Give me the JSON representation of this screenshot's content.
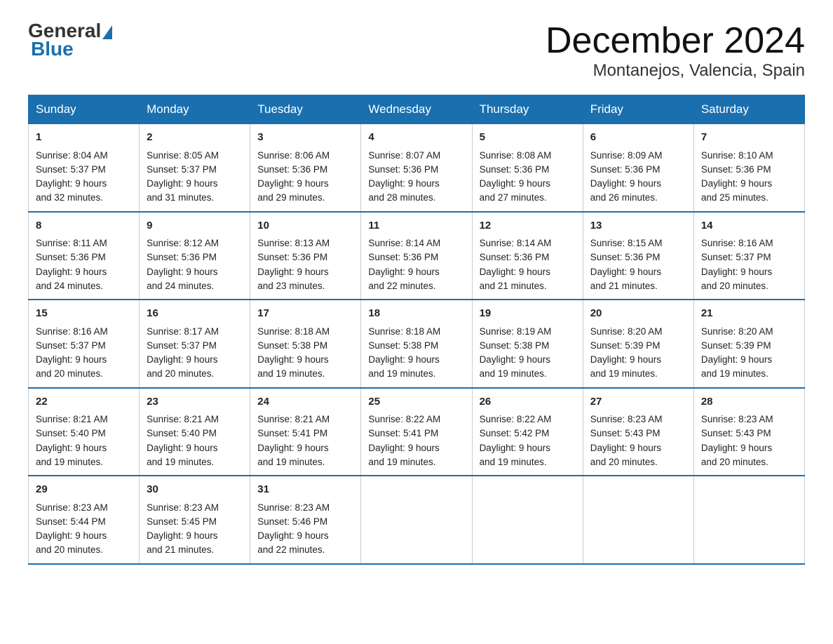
{
  "logo": {
    "general": "General",
    "blue": "Blue"
  },
  "header": {
    "month_year": "December 2024",
    "location": "Montanejos, Valencia, Spain"
  },
  "days_of_week": [
    "Sunday",
    "Monday",
    "Tuesday",
    "Wednesday",
    "Thursday",
    "Friday",
    "Saturday"
  ],
  "weeks": [
    [
      {
        "day": 1,
        "sunrise": "8:04 AM",
        "sunset": "5:37 PM",
        "daylight": "9 hours and 32 minutes."
      },
      {
        "day": 2,
        "sunrise": "8:05 AM",
        "sunset": "5:37 PM",
        "daylight": "9 hours and 31 minutes."
      },
      {
        "day": 3,
        "sunrise": "8:06 AM",
        "sunset": "5:36 PM",
        "daylight": "9 hours and 29 minutes."
      },
      {
        "day": 4,
        "sunrise": "8:07 AM",
        "sunset": "5:36 PM",
        "daylight": "9 hours and 28 minutes."
      },
      {
        "day": 5,
        "sunrise": "8:08 AM",
        "sunset": "5:36 PM",
        "daylight": "9 hours and 27 minutes."
      },
      {
        "day": 6,
        "sunrise": "8:09 AM",
        "sunset": "5:36 PM",
        "daylight": "9 hours and 26 minutes."
      },
      {
        "day": 7,
        "sunrise": "8:10 AM",
        "sunset": "5:36 PM",
        "daylight": "9 hours and 25 minutes."
      }
    ],
    [
      {
        "day": 8,
        "sunrise": "8:11 AM",
        "sunset": "5:36 PM",
        "daylight": "9 hours and 24 minutes."
      },
      {
        "day": 9,
        "sunrise": "8:12 AM",
        "sunset": "5:36 PM",
        "daylight": "9 hours and 24 minutes."
      },
      {
        "day": 10,
        "sunrise": "8:13 AM",
        "sunset": "5:36 PM",
        "daylight": "9 hours and 23 minutes."
      },
      {
        "day": 11,
        "sunrise": "8:14 AM",
        "sunset": "5:36 PM",
        "daylight": "9 hours and 22 minutes."
      },
      {
        "day": 12,
        "sunrise": "8:14 AM",
        "sunset": "5:36 PM",
        "daylight": "9 hours and 21 minutes."
      },
      {
        "day": 13,
        "sunrise": "8:15 AM",
        "sunset": "5:36 PM",
        "daylight": "9 hours and 21 minutes."
      },
      {
        "day": 14,
        "sunrise": "8:16 AM",
        "sunset": "5:37 PM",
        "daylight": "9 hours and 20 minutes."
      }
    ],
    [
      {
        "day": 15,
        "sunrise": "8:16 AM",
        "sunset": "5:37 PM",
        "daylight": "9 hours and 20 minutes."
      },
      {
        "day": 16,
        "sunrise": "8:17 AM",
        "sunset": "5:37 PM",
        "daylight": "9 hours and 20 minutes."
      },
      {
        "day": 17,
        "sunrise": "8:18 AM",
        "sunset": "5:38 PM",
        "daylight": "9 hours and 19 minutes."
      },
      {
        "day": 18,
        "sunrise": "8:18 AM",
        "sunset": "5:38 PM",
        "daylight": "9 hours and 19 minutes."
      },
      {
        "day": 19,
        "sunrise": "8:19 AM",
        "sunset": "5:38 PM",
        "daylight": "9 hours and 19 minutes."
      },
      {
        "day": 20,
        "sunrise": "8:20 AM",
        "sunset": "5:39 PM",
        "daylight": "9 hours and 19 minutes."
      },
      {
        "day": 21,
        "sunrise": "8:20 AM",
        "sunset": "5:39 PM",
        "daylight": "9 hours and 19 minutes."
      }
    ],
    [
      {
        "day": 22,
        "sunrise": "8:21 AM",
        "sunset": "5:40 PM",
        "daylight": "9 hours and 19 minutes."
      },
      {
        "day": 23,
        "sunrise": "8:21 AM",
        "sunset": "5:40 PM",
        "daylight": "9 hours and 19 minutes."
      },
      {
        "day": 24,
        "sunrise": "8:21 AM",
        "sunset": "5:41 PM",
        "daylight": "9 hours and 19 minutes."
      },
      {
        "day": 25,
        "sunrise": "8:22 AM",
        "sunset": "5:41 PM",
        "daylight": "9 hours and 19 minutes."
      },
      {
        "day": 26,
        "sunrise": "8:22 AM",
        "sunset": "5:42 PM",
        "daylight": "9 hours and 19 minutes."
      },
      {
        "day": 27,
        "sunrise": "8:23 AM",
        "sunset": "5:43 PM",
        "daylight": "9 hours and 20 minutes."
      },
      {
        "day": 28,
        "sunrise": "8:23 AM",
        "sunset": "5:43 PM",
        "daylight": "9 hours and 20 minutes."
      }
    ],
    [
      {
        "day": 29,
        "sunrise": "8:23 AM",
        "sunset": "5:44 PM",
        "daylight": "9 hours and 20 minutes."
      },
      {
        "day": 30,
        "sunrise": "8:23 AM",
        "sunset": "5:45 PM",
        "daylight": "9 hours and 21 minutes."
      },
      {
        "day": 31,
        "sunrise": "8:23 AM",
        "sunset": "5:46 PM",
        "daylight": "9 hours and 22 minutes."
      },
      null,
      null,
      null,
      null
    ]
  ],
  "labels": {
    "sunrise": "Sunrise:",
    "sunset": "Sunset:",
    "daylight": "Daylight:"
  }
}
